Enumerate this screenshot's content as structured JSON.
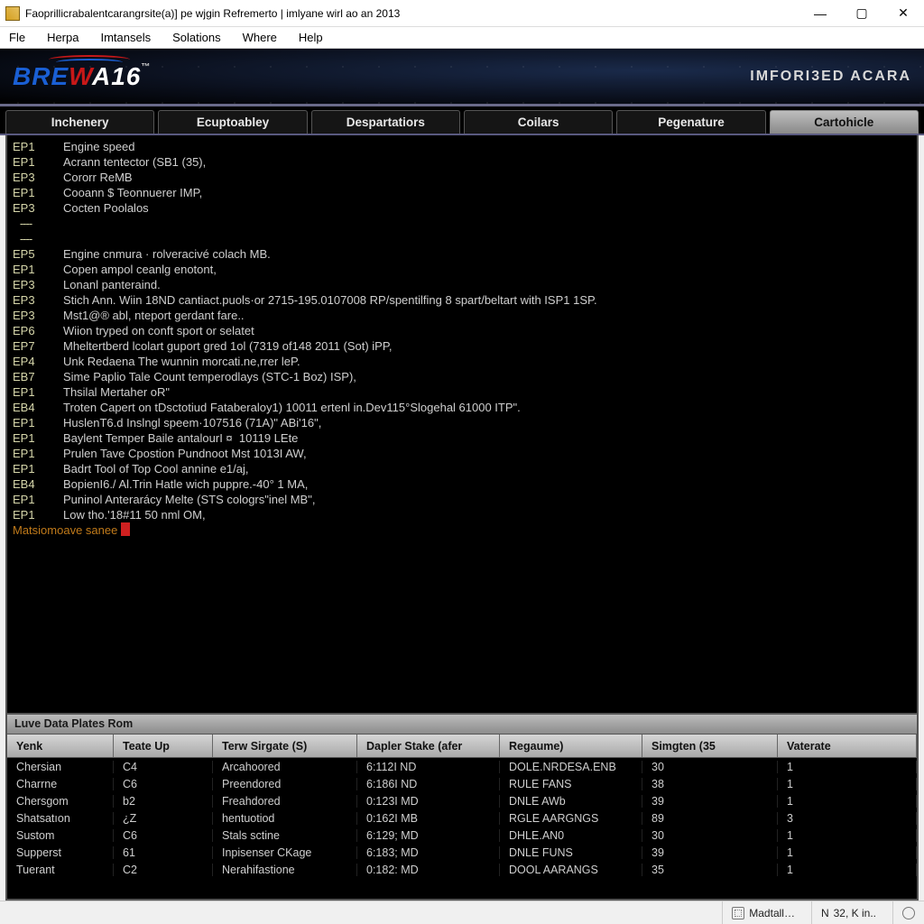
{
  "title": "Faoprillicrabalentcarangrsite(a)] pe wjgin Refremerto | imlyane wirl ao an 2013",
  "menu": {
    "file": "Fle",
    "herpa": "Herpa",
    "imtansels": "Imtansels",
    "solations": "Solations",
    "where": "Where",
    "help": "Help"
  },
  "banner_right": "IMFORI3ED ACARA",
  "logo": {
    "part1": "BRE",
    "part2": "W",
    "part3": "A16",
    "tm": "™"
  },
  "tabs": [
    "Inchenery",
    "Ecuptoabley",
    "Despartatiors",
    "Coilars",
    "Pegenature",
    "Cartohicle"
  ],
  "active_tab_index": 5,
  "terminal_lines": [
    {
      "code": "EP1",
      "text": "Engine speed"
    },
    {
      "code": "EP1",
      "text": "Acrann tentector (SB1 (35),"
    },
    {
      "code": "EP3",
      "text": "Cororr ReMB"
    },
    {
      "code": "EP1",
      "text": "Cooann $ Teonnuerer IMP,"
    },
    {
      "code": "EP3",
      "text": "Cocten Poolalos"
    },
    {
      "sep": "----"
    },
    {
      "sep": "----"
    },
    {
      "code": "EP5",
      "text": "Engine cnmura · rolveracivé colach MB."
    },
    {
      "code": "EP1",
      "text": "Copen ampol ceanlg enotont,"
    },
    {
      "code": "EP3",
      "text": "Lonanl panteraind."
    },
    {
      "code": "EP3",
      "text": "Stich Ann. Wiin 18ND cantiact.puols·or 2715-195.0107008 RP/spentilfing 8 spart/beltart with ISP1 1SP."
    },
    {
      "code": "EP3",
      "text": "Mst1@® abl, nteport gerdant fare.."
    },
    {
      "code": "EP6",
      "text": "Wiion tryped on conft sport or selatet"
    },
    {
      "code": "EP7",
      "text": "Mheltertberd lcolart guport gred 1ol (7319 of148 2011 (Sot) iPP,"
    },
    {
      "code": "EP4",
      "text": "Unk Redaena The wunnin morcati.ne,rrer leP."
    },
    {
      "code": "EB7",
      "text": "Sime Paplio Tale Count temperodlays (STC-1 Boz) ISP),"
    },
    {
      "code": "EP1",
      "text": "Thsilal Mertaher oR\""
    },
    {
      "code": "EB4",
      "text": "Troten Capert on tDsctotiud Fataberaloy1) 10011 ertenl in.Dev115°Slogehal 61000 ITP\"."
    },
    {
      "code": "EP1",
      "text": "HuslenT6.d Inslngl speem·107516 (71A)\" ABi'16\","
    },
    {
      "code": "EP1",
      "text": "Baylent Temper Baile antalourI ¤  10119 LEte"
    },
    {
      "code": "EP1",
      "text": "Prulen Tave Cpostion Pundnoot Mst 1013I AW,"
    },
    {
      "code": "EP1",
      "text": "Badrt Tool of Top Cool annine e1/aj,"
    },
    {
      "code": "EB4",
      "text": "BopienI6./ Al.Trin Hatle wich puppre.-40° 1 MA,"
    },
    {
      "code": "EP1",
      "text": "Puninol Anterarácy Melte (STS cologrs\"inel MB\","
    },
    {
      "code": "EP1",
      "text": "Low tho.'18#11 50 nml OM,"
    }
  ],
  "prompt_text": "Matsiomoave sanee",
  "panel_title": "Luve Data Plates Rom",
  "columns": [
    "Yenk",
    "Teate Up",
    "Terw Sirgate (S)",
    "Dapler Stake (afer",
    "Regaume)",
    "Simgten (35",
    "Vaterate"
  ],
  "rows": [
    [
      "Chersian",
      "C4",
      "Arcahoored",
      "6:112I ND",
      "DOLE.NRDESA.ENB",
      "30",
      "1"
    ],
    [
      "Charrne",
      "C6",
      "Preendored",
      "6:186I ND",
      "RULE FANS",
      "38",
      "1"
    ],
    [
      "Chersgom",
      "b2",
      "Freahdored",
      "0:123I MD",
      "DNLE AWb",
      "39",
      "1"
    ],
    [
      "Shatsatıon",
      "¿Z",
      "hentuotiod",
      "0:162I MB",
      "RGLE AARGNGS",
      "89",
      "3"
    ],
    [
      "Sustom",
      "C6",
      "Stals sctine",
      "6:129; MD",
      "DHLE.AN0",
      "30",
      "1"
    ],
    [
      "Supperst",
      "61",
      "Inpisenser CKage",
      "6:183; MD",
      "DNLE FUNS",
      "39",
      "1"
    ],
    [
      "Tuerant",
      "C2",
      "Nerahifastione",
      "0:182: MD",
      "DOOL AARANGS",
      "35",
      "1"
    ]
  ],
  "status": {
    "ime": "Madtall…",
    "kbd_prefix": "N",
    "kbd": "32, K in.."
  }
}
